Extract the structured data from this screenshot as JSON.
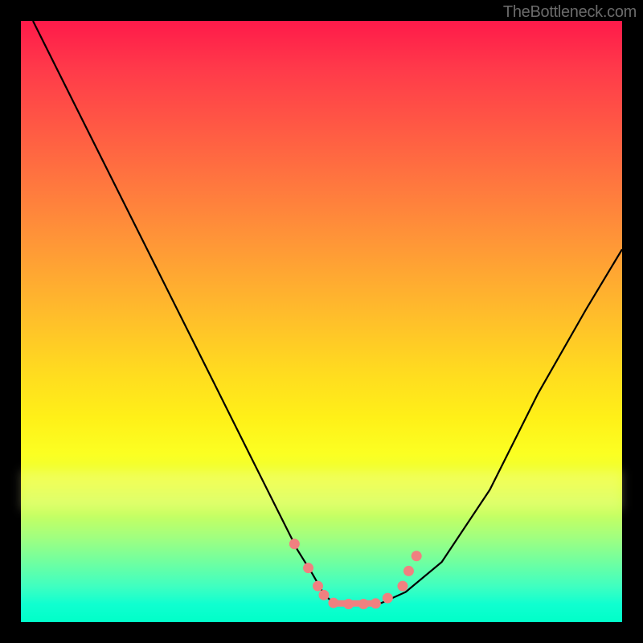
{
  "watermark": "TheBottleneck.com",
  "chart_data": {
    "type": "line",
    "title": "",
    "xlabel": "",
    "ylabel": "",
    "xlim": [
      0,
      100
    ],
    "ylim": [
      0,
      100
    ],
    "series": [
      {
        "name": "bottleneck-curve",
        "x": [
          2,
          8,
          14,
          20,
          26,
          32,
          38,
          43,
          46,
          48.5,
          50.5,
          52,
          55,
          58,
          60,
          64,
          70,
          78,
          86,
          94,
          100
        ],
        "y": [
          100,
          88,
          76,
          64,
          52,
          40,
          28,
          18,
          12,
          8,
          4.5,
          3.2,
          3.0,
          3.0,
          3.2,
          5,
          10,
          22,
          38,
          52,
          62
        ]
      }
    ],
    "markers": [
      {
        "name": "marker-left-upper",
        "x": 45.5,
        "y": 13.0
      },
      {
        "name": "marker-left-mid",
        "x": 47.8,
        "y": 9.0
      },
      {
        "name": "marker-left-low1",
        "x": 49.4,
        "y": 6.0
      },
      {
        "name": "marker-left-low2",
        "x": 50.4,
        "y": 4.5
      },
      {
        "name": "marker-flat-1",
        "x": 52.0,
        "y": 3.2
      },
      {
        "name": "marker-flat-2",
        "x": 54.5,
        "y": 3.0
      },
      {
        "name": "marker-flat-3",
        "x": 57.0,
        "y": 3.0
      },
      {
        "name": "marker-flat-4",
        "x": 59.0,
        "y": 3.1
      },
      {
        "name": "marker-right-low",
        "x": 61.0,
        "y": 4.0
      },
      {
        "name": "marker-right-mid",
        "x": 63.5,
        "y": 6.0
      },
      {
        "name": "marker-right-upper1",
        "x": 64.5,
        "y": 8.5
      },
      {
        "name": "marker-right-upper2",
        "x": 65.8,
        "y": 11.0
      }
    ],
    "flat_segment": {
      "x1": 51.8,
      "x2": 59.2,
      "y": 3.1
    }
  }
}
